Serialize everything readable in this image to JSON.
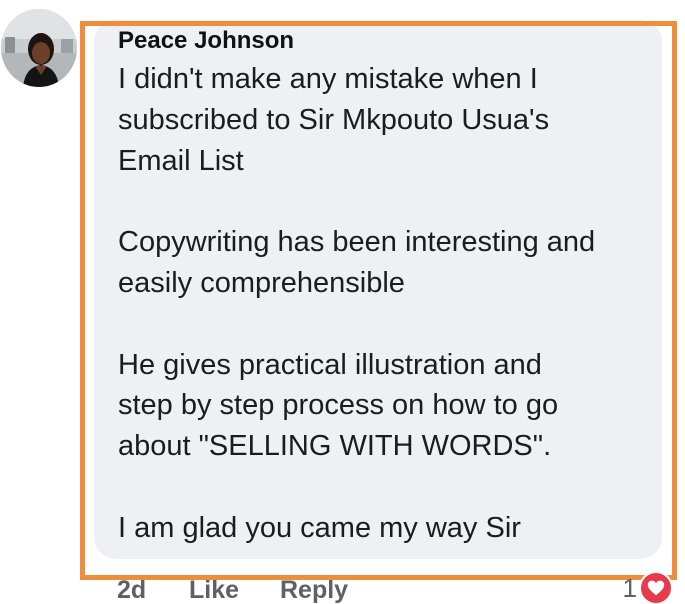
{
  "comment": {
    "author": "Peace Johnson",
    "lines": [
      "I didn't make any mistake when I",
      "subscribed to Sir Mkpouto Usua's",
      "Email List",
      "",
      "Copywriting has been interesting and",
      "easily comprehensible",
      "",
      "He gives practical illustration and",
      "step by step process on how to go",
      "about \"SELLING WITH WORDS\".",
      "",
      "I am glad you came my way Sir"
    ]
  },
  "actions": {
    "time": "2d",
    "like_label": "Like",
    "reply_label": "Reply"
  },
  "reactions": {
    "count": "1",
    "icon": "heart-icon"
  },
  "colors": {
    "highlight_border": "#ee8d3a",
    "bubble_bg": "#eff0f3",
    "heart": "#e83a4a"
  }
}
